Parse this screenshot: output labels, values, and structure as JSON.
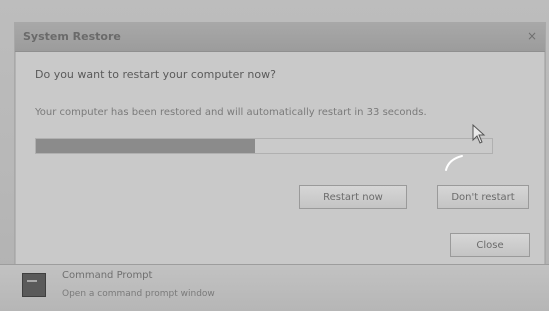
{
  "dialog": {
    "title": "System Restore",
    "heading": "Do you want to restart your computer now?",
    "message": "Your computer has been restored and will automatically restart in 33 seconds.",
    "progress_fraction": 0.48,
    "restart_now_label": "Restart now",
    "dont_restart_label": "Don't restart",
    "close_label": "Close",
    "close_glyph": "×"
  },
  "lower_panel": {
    "title": "Command Prompt",
    "subtitle": "Open a command prompt window",
    "icon": "command-prompt-icon"
  },
  "colors": {
    "background": "#bdbdbd",
    "dialog": "#c9c9c9",
    "progress_fill": "#8b8b8b"
  }
}
